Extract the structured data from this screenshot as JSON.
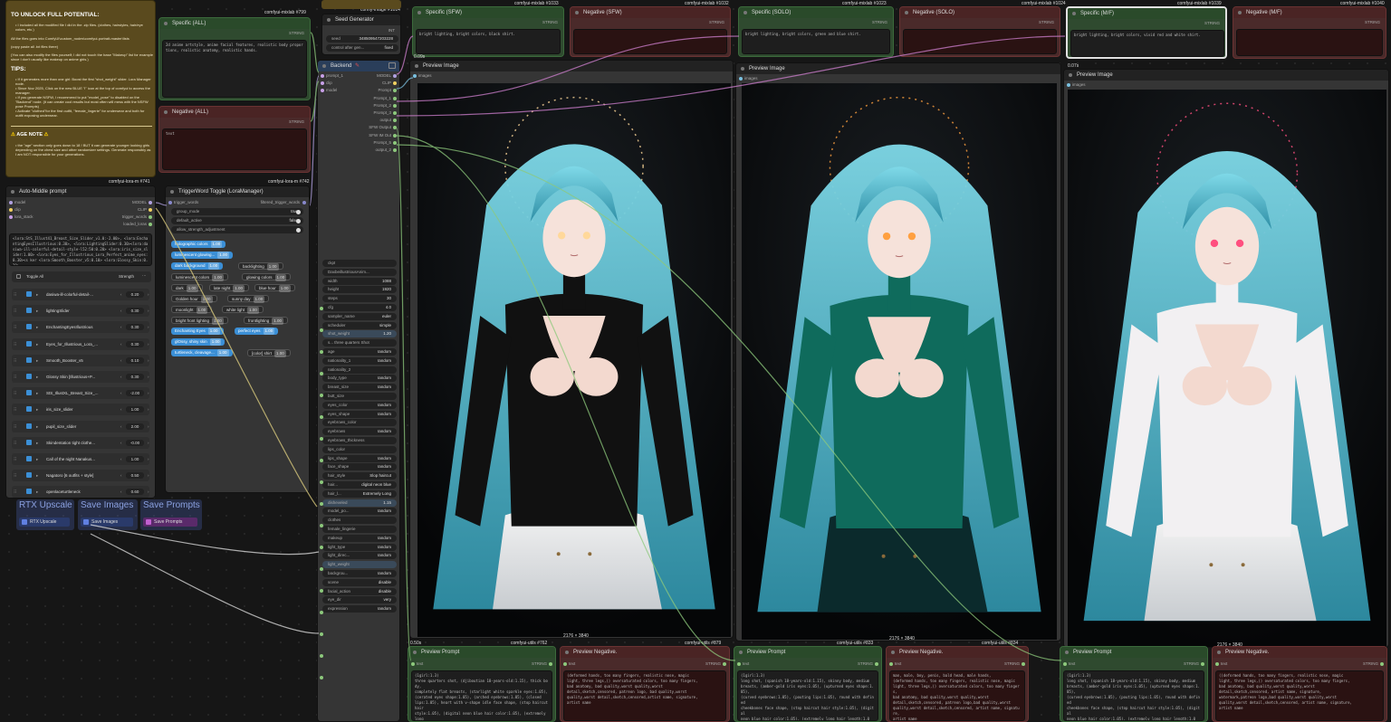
{
  "notes": {
    "heading": "TO UNLOCK FULL POTENTIAL:",
    "p1": "• I included all the modified file I did in the .zip files. (clothes, hairstyles, hair/eye colors, etc.)",
    "p2": "All the files goes into ComfyUI\\custom_nodes\\comfyui-portrait-master\\lists",
    "p3": "(copy paste all .txt files there)",
    "p4": "(You can also modify the files yourself; I did not touch the base \"Makeup\" list for example since I don't usually like makeup on anime girls.)",
    "tips_heading": "TIPS:",
    "tips": "• If it generates more than one girl: Boost the first \"shot_weight\" slider. Lora Manager node.\n• Since Nov 2025, Click on the new BLUE \"i\" icon at the top of comfyui to access the manager.\n• If you generate NSFW, I recommend to put \"model_pose\" to disabled on the \"Backend\" node. (it can create cool results but most often will mess with the NSFW pose Prompts)\n• Activate \"clothed\"for the first outfit, \"female_lingerie\" for underwear and both for outfit exposing underwear.",
    "age_heading": "AGE NOTE",
    "age_text": "• the \"age\" section only goes down to 18 ! BUT it can generate younger looking girls depending on the chest size and other randomizer settings. Generate responsibly as I am NOT responsible for your generations."
  },
  "specific_all": {
    "title": "Specific (ALL)",
    "badge": "comfyui-mixlab #799",
    "string_label": "STRING",
    "text": "2d anime artstyle, anime facial features, realistic body proportions, realistic anatomy, realistic hands."
  },
  "negative_all": {
    "title": "Negative (ALL)",
    "string_label": "STRING",
    "text": "text"
  },
  "seed_gen": {
    "title": "Seed Generator",
    "badge": "comfy-image #1014",
    "int_label": "INT",
    "seed_label": "seed",
    "seed_value": "348509547203228",
    "control_label": "control after gen...",
    "control_value": "fixed"
  },
  "backend": {
    "title": "Backend",
    "inputs": [
      "prompt_1",
      "clip",
      "model"
    ],
    "outputs": [
      "MODEL",
      "CLIP",
      "Prompt",
      "Prompt_1",
      "Prompt_2",
      "Prompt_3",
      "output",
      "SFW Output",
      "SFW IM Out",
      "Prompt_5",
      "output_2"
    ],
    "widgets": [
      {
        "label": "ckpt",
        "value": ""
      },
      {
        "label": "DaxbeillustriousAnim...",
        "value": ""
      },
      {
        "label": "width",
        "value": "1088"
      },
      {
        "label": "height",
        "value": "1920"
      },
      {
        "label": "steps",
        "value": "30"
      },
      {
        "label": "cfg",
        "value": "4.0"
      },
      {
        "label": "sampler_name",
        "value": "euler"
      },
      {
        "label": "scheduler",
        "value": "simple"
      },
      {
        "label": "shot_weight",
        "value": "1.20"
      },
      {
        "label": "s... three quarters Shot",
        "value": ""
      },
      {
        "label": "age",
        "value": "random"
      },
      {
        "label": "nationality_1",
        "value": "random"
      },
      {
        "label": "nationality_2",
        "value": ""
      },
      {
        "label": "body_type",
        "value": "random"
      },
      {
        "label": "breast_size",
        "value": "random"
      },
      {
        "label": "butt_size",
        "value": ""
      },
      {
        "label": "eyes_color",
        "value": "random"
      },
      {
        "label": "eyes_shape",
        "value": "random"
      },
      {
        "label": "eyebrows_color",
        "value": ""
      },
      {
        "label": "eyebrows",
        "value": "random"
      },
      {
        "label": "eyebrows_thickness",
        "value": ""
      },
      {
        "label": "lips_color",
        "value": ""
      },
      {
        "label": "lips_shape",
        "value": "random"
      },
      {
        "label": "face_shape",
        "value": "random"
      },
      {
        "label": "hair_style",
        "value": "Slop haircut"
      },
      {
        "label": "hair...",
        "value": "digital neon blue"
      },
      {
        "label": "hair_l...",
        "value": "Extremely Long"
      },
      {
        "label": "disheveled",
        "value": "1.15"
      },
      {
        "label": "model_po...",
        "value": "random"
      },
      {
        "label": "clothes",
        "value": ""
      },
      {
        "label": "female_lingerie",
        "value": ""
      },
      {
        "label": "makeup",
        "value": "random"
      },
      {
        "label": "light_type",
        "value": "random"
      },
      {
        "label": "light_direc...",
        "value": "random"
      },
      {
        "label": "light_weight",
        "value": ""
      },
      {
        "label": "backgrou...",
        "value": "random"
      },
      {
        "label": "scene",
        "value": "disable"
      },
      {
        "label": "facial_action",
        "value": "disable"
      },
      {
        "label": "eye_dir",
        "value": "very"
      },
      {
        "label": "expression",
        "value": "random"
      }
    ]
  },
  "auto_middle": {
    "title": "Auto-Middle prompt",
    "badge": "comfyui-lora-m #741",
    "inputs": [
      "model",
      "clip",
      "lora_stack"
    ],
    "outputs": [
      "MODEL",
      "CLIP",
      "trigger_words",
      "loaded_loras"
    ],
    "text": "<lora:StS_Illust41_Breast_Size_Slider_v1.0:-2.00>, <lora:EnchantingEyesIllustrious:0.30>, <lora:LightingSlider:0.30><lora:dasiwa-ill-colorful-detail-style-l52:50:0.20> <lora:iris_size_slider:1.00> <lora:Eyes_for_Illustrious_Lora_Perfect_anime_eyes:0.30><s ker <lora:Smooth_Booster_v5:0.10> <lora:Glossy_Skin:0.30>",
    "toggle_all": "Toggle All",
    "strength_label": "Strength",
    "loras": [
      {
        "name": "dasiwa-ill-colorful-detail-...",
        "value": "0.20"
      },
      {
        "name": "lightingSlider",
        "value": "0.30"
      },
      {
        "name": "EnchantingEyesIllustrious",
        "value": "0.30"
      },
      {
        "name": "Eyes_for_Illustrious_Lora_...",
        "value": "0.30"
      },
      {
        "name": "Smooth_Booster_v5",
        "value": "0.10"
      },
      {
        "name": "Glossy Skin [Illustrious+P...",
        "value": "0.30"
      },
      {
        "name": "StS_IllustXL_Breast_Size_...",
        "value": "-2.00"
      },
      {
        "name": "iris_size_slider",
        "value": "1.00"
      },
      {
        "name": "pupil_size_slider",
        "value": "2.00"
      },
      {
        "name": "Skindentation tight clothe...",
        "value": "-0.00"
      },
      {
        "name": "Call of the night Nanakus...",
        "value": "1.00"
      },
      {
        "name": "Nagatoro [6 outfits + style]",
        "value": "0.50"
      },
      {
        "name": "openlaceturtleneck",
        "value": "0.60"
      }
    ]
  },
  "trigger_toggle": {
    "title": "TriggerWord Toggle (LoraManager)",
    "badge": "comfyui-lora-m #742",
    "input": "trigger_words",
    "output": "filtered_trigger_words",
    "widgets": [
      {
        "label": "group_mode",
        "value": "true"
      },
      {
        "label": "default_active",
        "value": "false"
      },
      {
        "label": "allow_strength_adjustment",
        "value": ""
      }
    ],
    "chips": [
      {
        "label": "holographic colors",
        "w": "1.00",
        "on": true
      },
      {
        "label": "luminescent glowing...",
        "w": "1.00",
        "on": true
      },
      {
        "label": "dark background",
        "w": "1.00",
        "on": true
      },
      {
        "label": "backlighting",
        "w": "1.00",
        "on": false
      },
      {
        "label": "luminescent colors",
        "w": "1.00",
        "on": false
      },
      {
        "label": "glowing colors",
        "w": "1.00",
        "on": false
      },
      {
        "label": "dark",
        "w": "1.00",
        "on": false
      },
      {
        "label": "late night",
        "w": "1.00",
        "on": false
      },
      {
        "label": "blue hour",
        "w": "1.00",
        "on": false
      },
      {
        "label": "Golden hour",
        "w": "1.00",
        "on": false
      },
      {
        "label": "sunny day",
        "w": "1.00",
        "on": false
      },
      {
        "label": "moonlight",
        "w": "1.00",
        "on": false
      },
      {
        "label": "white light",
        "w": "1.00",
        "on": false
      },
      {
        "label": "bright front lighting",
        "w": "1.00",
        "on": false
      },
      {
        "label": "frontlighting",
        "w": "1.00",
        "on": false
      },
      {
        "label": "Enchanting Eyes",
        "w": "1.00",
        "on": true
      },
      {
        "label": "perfect eyes",
        "w": "1.00",
        "on": true
      },
      {
        "label": "glOssy, shiny skin",
        "w": "1.00",
        "on": true
      },
      {
        "label": "turtleneck, cleavage...",
        "w": "1.00",
        "on": true
      },
      {
        "label": "[color] shirt",
        "w": "1.00",
        "on": false
      }
    ]
  },
  "bottom_groups": [
    {
      "title": "RTX Upscale",
      "button": "RTX Upscale"
    },
    {
      "title": "Save Images",
      "button": "Save Images"
    },
    {
      "title": "Save Prompts",
      "button": "Save Prompts"
    }
  ],
  "prompt_nodes": [
    {
      "title": "Specific (SFW)",
      "badge": "comfyui-mixlab #1033",
      "string_label": "STRING",
      "text": "bright lighting, bright colors, black shirt."
    },
    {
      "title": "Negative (SFW)",
      "badge": "comfyui-mixlab #1032",
      "string_label": "STRING",
      "text": ""
    },
    {
      "title": "Specific (SOLO)",
      "badge": "comfyui-mixlab #1023",
      "string_label": "STRING",
      "text": "bright lighting, bright colors, green and blue shirt."
    },
    {
      "title": "Negative (SOLO)",
      "badge": "comfyui-mixlab #1024",
      "string_label": "STRING",
      "text": ""
    },
    {
      "title": "Specific (M/F)",
      "badge": "comfyui-mixlab #1039",
      "string_label": "STRING",
      "text": "bright lighting, bright colors, vivid red and white shirt."
    },
    {
      "title": "Negative (M/F)",
      "badge": "comfyui-mixlab #1040",
      "string_label": "STRING",
      "text": ""
    }
  ],
  "previews": [
    {
      "title": "Preview Image",
      "input": "images",
      "badge": "0.09s",
      "size": "2176 × 3840",
      "outfit": "#111111",
      "accent": "#ffd89a"
    },
    {
      "title": "Preview Image",
      "input": "images",
      "badge": "",
      "size": "2176 × 3840",
      "outfit": "#0f6b5c",
      "accent": "#ffa040"
    },
    {
      "title": "Preview Image",
      "input": "images",
      "badge": "0.07s",
      "size": "2176 × 3840",
      "outfit": "#f2f0f2",
      "accent": "#ff4f7f"
    }
  ],
  "bottom_prompts": [
    {
      "title": "Preview Prompt",
      "badge": "comfyui-utils #762",
      "input": "text",
      "string_label": "STRING",
      "timer": "0.50s",
      "text": "(1girl:1.3)\nthree quarters shot, (djiboutian 18-years-old:1.15), thick body,\ncompletely flat breasts, (starlight white sparkle eyes:1.05),\n(cerated eyes shape:1.05), (arched eyebrows:1.05), (closed\nlips:1.05), heart with v-shape idle face shape, (stop haircut hair\nstyle:1.05), (digital neon blue hair color:1.05), (extremely long\nhair length:1.05), (disheveled:1.15),\n2d anime artstyle, anime facial features, realistic body\nproportions, realistic anatomy, realistic hands.\nbright lighting, bright colors, black shirt."
    },
    {
      "title": "Preview Negative.",
      "badge": "comfyui-utils #879",
      "input": "text",
      "string_label": "STRING",
      "timer": "",
      "text": "(deformed hands, too many fingers, realistic nose, magic\nlight, three legs,)) oversaturated colors, too many fingers,\nbad anatomy, bad quality,worst quality,worst\ndetail,sketch,censored, patreon logo, bad quality,worst\nquality,worst detail,sketch,censored,artist name, signature,\nartist name"
    },
    {
      "title": "Preview Prompt",
      "badge": "comfyui-utils #833",
      "input": "text",
      "string_label": "STRING",
      "timer": "",
      "text": "(1girl:1.3)\nlong shot, (spanish 18-years-old:1.15), skinny body, medium\nbreasts, (amber-gold iris eyes:1.05), (upturned eyes shape:1.05),\n(curved eyebrows:1.05), (pouting lips:1.05), round with defined\ncheekbones face shape, (stop haircut hair style:1.05), (digital\nneon blue hair color:1.05), (extremely long hair length:1.05),\n(disheveled:1.15),\n2d anime artstyle, anime facial features, realistic body\nproportions, realistic anatomy, realistic hands.\nbright lighting, bright colors, green and blue shirt."
    },
    {
      "title": "Preview Negative.",
      "badge": "comfyui-utils #834",
      "input": "text",
      "string_label": "STRING",
      "timer": "",
      "text": "man, male, boy, penis, bald head, male hands,\n(deformed hands, too many fingers, realistic nose, magic\nlight, three legs,)) oversaturated colors, too many fingers,\nbad anatomy, bad quality,worst quality,worst\ndetail,sketch,censored, patreon logo,bad quality,worst\nquality,worst detail,sketch,censored, artist name, signature,\nartist name"
    },
    {
      "title": "Preview Prompt",
      "badge": "",
      "input": "text",
      "string_label": "STRING",
      "timer": "",
      "text": "(1girl:1.3)\nlong shot, (spanish 18-years-old:1.15), skinny body, medium\nbreasts, (amber-gold iris eyes:1.05), (upturned eyes shape:1.05),\n(curved eyebrows:1.05), (pouting lips:1.05), round with defined\ncheekbones face shape, (stop haircut hair style:1.05), (digital\nneon blue hair color:1.05), (extremely long hair length:1.05),\n(disheveled:1.15),\n2d anime artstyle, anime facial features, realistic body\nproportions, realistic anatomy, realistic hands.\nbright lighting, bright colors, vivid red and white shirt."
    },
    {
      "title": "Preview Negative.",
      "badge": "",
      "input": "text",
      "string_label": "STRING",
      "timer": "",
      "text": "((deformed hands, too many fingers, realistic nose, magic\nlight, three legs,)) oversaturated colors, too many fingers,\nbad anatomy, bad quality,worst quality,worst\ndetail,sketch,censored, artist name, signature,\nwatermark,patreon logo,bad quality,worst quality,worst\nquality,worst detail,sketch,censored, artist name, signature,\nartist name"
    }
  ],
  "colors": {
    "note_bg": "#5a4a1e",
    "green_node": "#2f4a2f",
    "red_node": "#4a2a2a",
    "accent_blue": "#3b8fd6",
    "hair": "#7fd9e8"
  }
}
